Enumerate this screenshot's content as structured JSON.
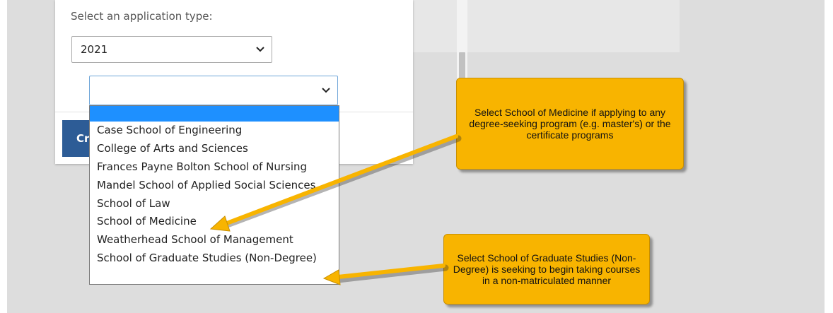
{
  "form": {
    "application_type_label": "Select an application type:",
    "year_select_value": "2021",
    "school_select_value": "",
    "create_button_label": "Create"
  },
  "dropdown": {
    "options": [
      "",
      "Case School of Engineering",
      "College of Arts and Sciences",
      "Frances Payne Bolton School of Nursing",
      "Mandel School of Applied Social Sciences",
      "School of Law",
      "School of Medicine",
      "Weatherhead School of Management",
      "School of Graduate Studies (Non-Degree)"
    ],
    "highlight_color": "#1E90FF"
  },
  "callouts": {
    "medicine_note": "Select School of Medicine if applying to any degree-seeking program (e.g. master's) or the certificate programs",
    "graduate_note": "Select School of Graduate Studies (Non-Degree) is seeking to begin taking courses in a non-matriculated manner",
    "color": "#F8B400"
  },
  "colors": {
    "button_blue": "#2D5C96",
    "background_gray": "#DDDDDD"
  }
}
